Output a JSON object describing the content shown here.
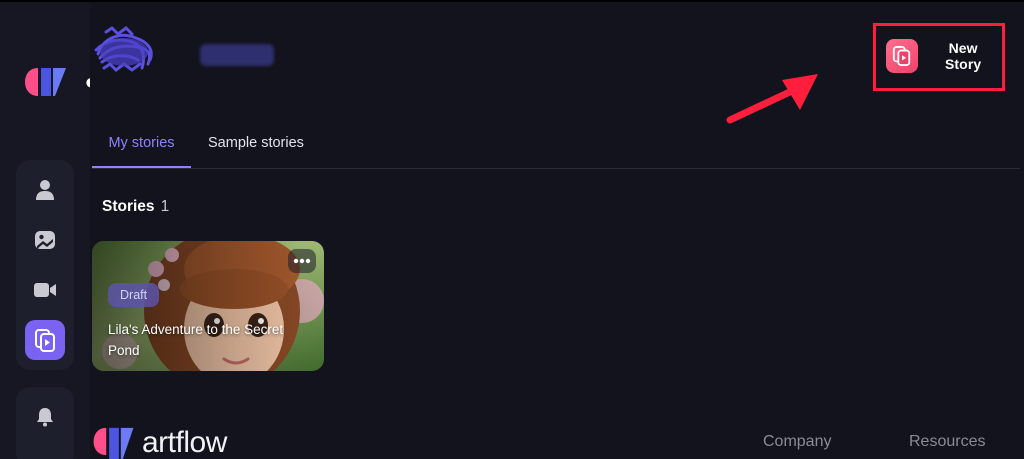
{
  "header": {
    "new_story_label": "New Story"
  },
  "tabs": [
    {
      "label": "My stories",
      "active": true
    },
    {
      "label": "Sample stories",
      "active": false
    }
  ],
  "stories": {
    "heading": "Stories",
    "count": "1",
    "items": [
      {
        "status": "Draft",
        "title": "Lila's Adventure to the Secret Pond"
      }
    ]
  },
  "sidebar": {
    "items": [
      {
        "icon": "person-icon",
        "active": false
      },
      {
        "icon": "image-icon",
        "active": false
      },
      {
        "icon": "video-icon",
        "active": false
      },
      {
        "icon": "story-icon",
        "active": true
      },
      {
        "icon": "bell-icon",
        "active": false
      }
    ]
  },
  "footer": {
    "wordmark": "artflow",
    "links": [
      "Company",
      "Resources"
    ]
  },
  "colors": {
    "background": "#12131c",
    "sidebar": "#161722",
    "accent": "#7a62f2",
    "tab_active": "#8f82ff",
    "new_story_icon": "#f0416b",
    "annotation_red": "#ff1f3d"
  }
}
